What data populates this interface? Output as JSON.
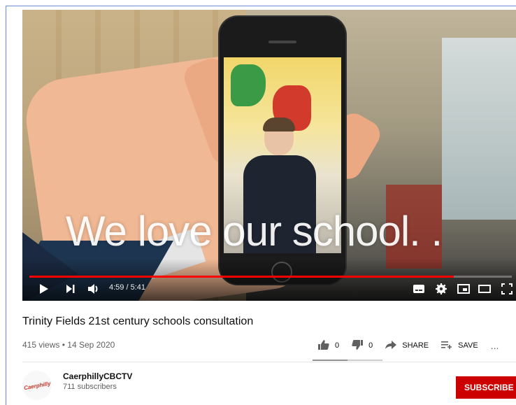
{
  "player": {
    "caption": "We love our school. .",
    "time_display": "4:59 / 5:41",
    "progress_fraction": 0.879,
    "accent": "#ff0000"
  },
  "video": {
    "title": "Trinity Fields 21st century schools consultation",
    "views": "415 views",
    "separator": "•",
    "date": "14 Sep 2020"
  },
  "actions": {
    "like_count": "0",
    "dislike_count": "0",
    "share_label": "SHARE",
    "save_label": "SAVE",
    "more_label": "..."
  },
  "channel": {
    "name": "CaerphillyCBCTV",
    "subscribers": "711 subscribers",
    "subscribe_label": "SUBSCRIBE",
    "subscribe_color": "#cc0000"
  },
  "icons": [
    "play-icon",
    "next-icon",
    "volume-icon",
    "subtitles-icon",
    "settings-icon",
    "miniplayer-icon",
    "theater-icon",
    "fullscreen-icon",
    "thumbs-up-icon",
    "thumbs-down-icon",
    "share-icon",
    "save-playlist-icon",
    "more-icon"
  ]
}
